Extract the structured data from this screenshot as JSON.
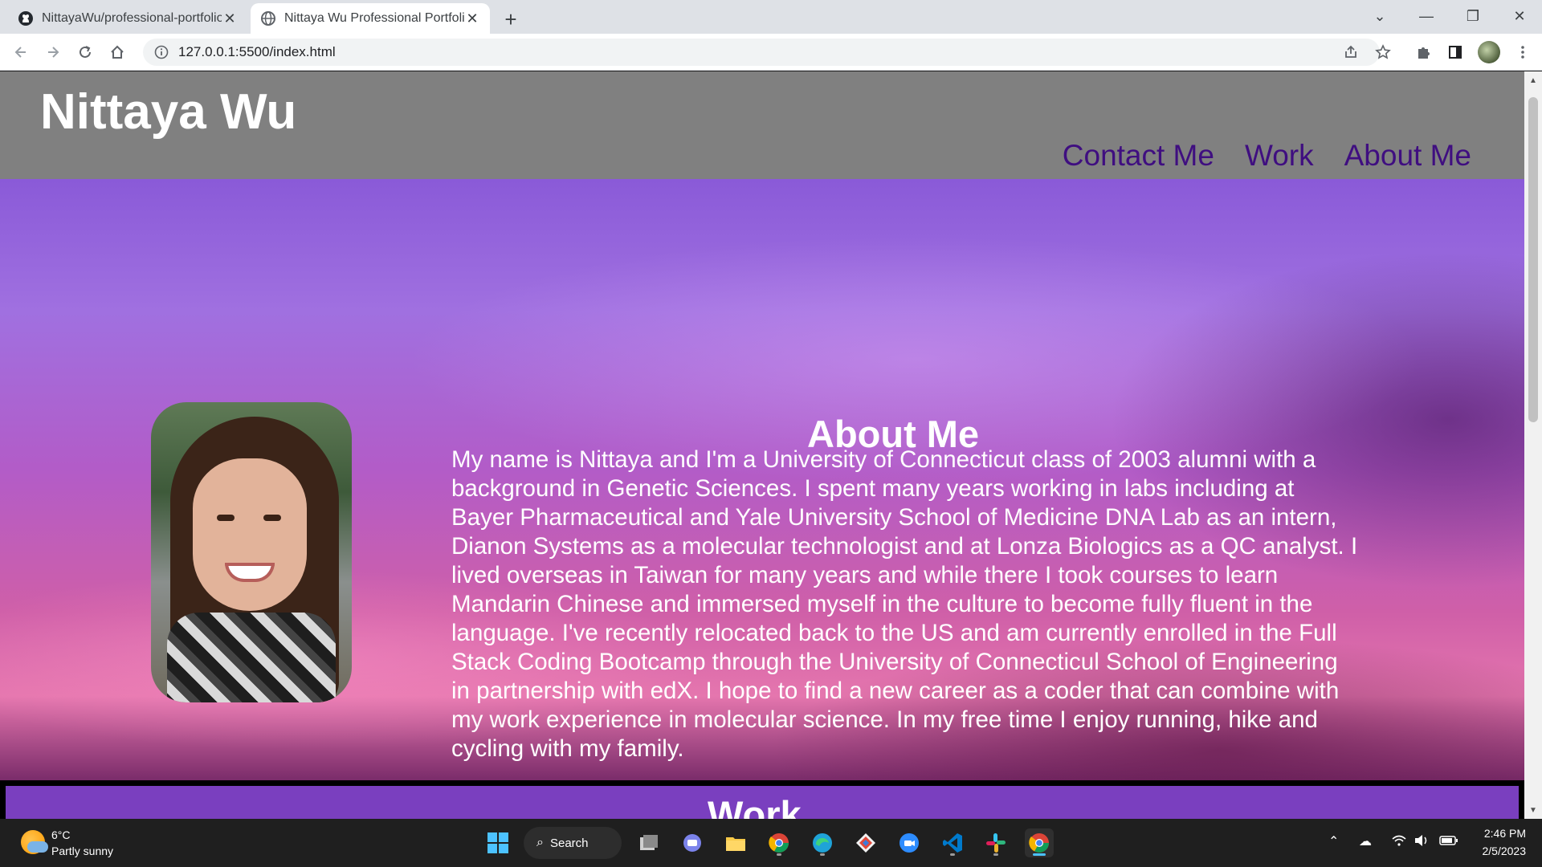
{
  "browser": {
    "tabs": [
      {
        "title": "NittayaWu/professional-portfolio",
        "icon": "github-icon",
        "active": false
      },
      {
        "title": "Nittaya Wu Professional Portfolio",
        "icon": "globe-icon",
        "active": true
      }
    ],
    "address": "127.0.0.1:5500/index.html"
  },
  "site": {
    "name": "Nittaya Wu",
    "nav": [
      "Contact Me",
      "Work",
      "About Me"
    ]
  },
  "about": {
    "title": "About Me",
    "text": "My name is Nittaya and I'm a University of Connecticut class of 2003 alumni with a background in Genetic Sciences. I spent many years working in labs including at Bayer Pharmaceutical and Yale University School of Medicine DNA Lab as an intern, Dianon Systems as a molecular technologist and at Lonza Biologics as a QC analyst. I lived overseas in Taiwan for many years and while there I took courses to learn Mandarin Chinese and immersed myself in the culture to become fully fluent in the language. I've recently relocated back to the US and am currently enrolled in the Full Stack Coding Bootcamp through the University of Connecticul School of Engineering in partnership with edX. I hope to find a new career as a coder that can combine with my work experience in molecular science. In my free time I enjoy running, hike and cycling with my family."
  },
  "work": {
    "title": "Work"
  },
  "taskbar": {
    "weather_temp": "6°C",
    "weather_desc": "Partly sunny",
    "search_label": "Search",
    "time": "2:46 PM",
    "date": "2/5/2023"
  },
  "colors": {
    "header_bg": "#808080",
    "nav_link": "#3f0e80",
    "work_band": "#7a3fbf"
  }
}
